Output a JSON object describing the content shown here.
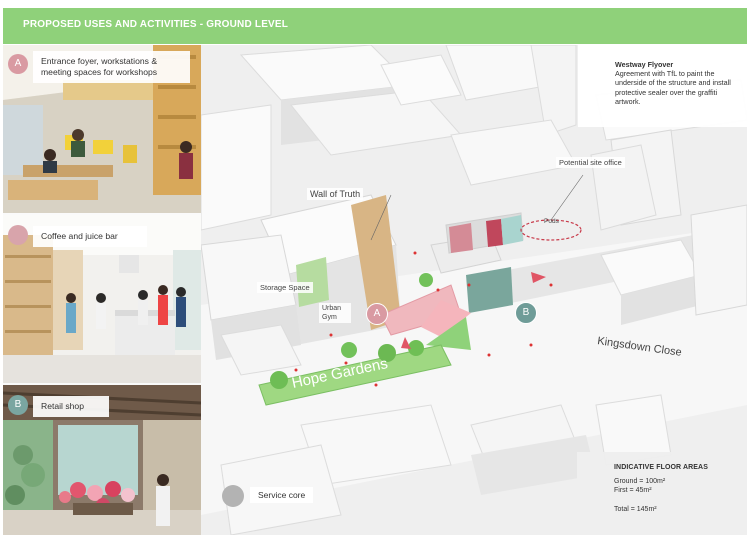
{
  "header": {
    "title": "PROPOSED USES AND ACTIVITIES - GROUND LEVEL"
  },
  "photos": [
    {
      "badge": "A",
      "caption": "Entrance foyer, workstations & meeting spaces for workshops"
    },
    {
      "badge": "",
      "caption": "Coffee and juice bar"
    },
    {
      "badge": "B",
      "caption": "Retail shop"
    }
  ],
  "map": {
    "callout_title": "Westway Flyover",
    "callout_body": "Agreement with TfL to paint the underside of the structure and install protective sealer over the graffiti artwork.",
    "labels": {
      "wall_of_truth": "Wall of Truth",
      "site_office": "Potential site office",
      "pods": "Pods",
      "storage": "Storage Space",
      "gym": "Urban Gym",
      "garden": "Hope Gardens",
      "street": "Kingsdown Close",
      "badge_a": "A",
      "badge_b": "B"
    },
    "service_core": "Service core"
  },
  "floor_areas": {
    "title": "INDICATIVE FLOOR AREAS",
    "ground": "Ground = 100m²",
    "first": "First = 45m²",
    "total": "Total = 145m²"
  },
  "colors": {
    "header": "#8fd17a",
    "badge_a": "#d99aa2",
    "badge_b": "#6f9c98",
    "garden": "#9fd882",
    "pink": "#e8a4ab",
    "teal": "#6e9e94"
  }
}
